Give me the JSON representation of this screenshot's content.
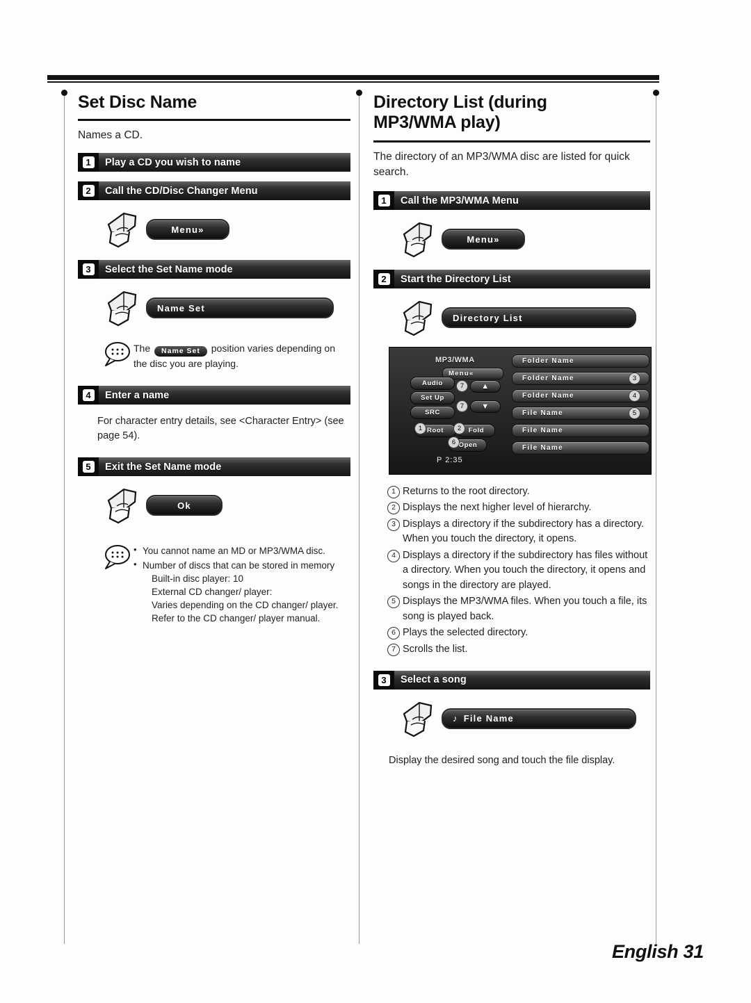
{
  "page": {
    "footer": "English 31"
  },
  "left": {
    "title": "Set Disc Name",
    "intro": "Names a CD.",
    "steps": [
      {
        "num": "1",
        "label": "Play a CD you wish to name"
      },
      {
        "num": "2",
        "label": "Call the CD/Disc Changer Menu"
      },
      {
        "num": "3",
        "label": "Select the Set Name mode"
      },
      {
        "num": "4",
        "label": "Enter a name"
      },
      {
        "num": "5",
        "label": "Exit the Set Name mode"
      }
    ],
    "buttons": {
      "menu": "Menu»",
      "name_set": "Name Set",
      "ok": "Ok"
    },
    "note1": {
      "prefix": "The",
      "pill": "Name Set",
      "suffix": "position varies depending on the disc you are playing."
    },
    "step4_text": "For character entry details, see <Character Entry> (see page 54).",
    "note2": [
      "You cannot name an MD or MP3/WMA disc.",
      "Number of discs that can be stored in memory"
    ],
    "note2_sub": [
      "Built-in disc player: 10",
      "External CD changer/ player:",
      "Varies depending on the CD changer/ player.",
      "Refer to the CD changer/ player manual."
    ]
  },
  "right": {
    "title": "Directory List (during MP3/WMA play)",
    "intro": "The directory of an MP3/WMA disc are listed for quick search.",
    "steps": [
      {
        "num": "1",
        "label": "Call the MP3/WMA Menu"
      },
      {
        "num": "2",
        "label": "Start the Directory List"
      },
      {
        "num": "3",
        "label": "Select a song"
      }
    ],
    "buttons": {
      "menu": "Menu»",
      "directory_list": "Directory List",
      "file_name": "File Name"
    },
    "device": {
      "title": "MP3/WMA",
      "menu_tab": "Menu«",
      "left_buttons": [
        "Audio",
        "Set Up",
        "SRC"
      ],
      "root": "Root",
      "folder": "Fold",
      "open": "Open",
      "time": "P  2:35",
      "rows": [
        {
          "text": "Folder Name",
          "badge": ""
        },
        {
          "text": "Folder Name",
          "badge": "3"
        },
        {
          "text": "Folder Name",
          "badge": "4"
        },
        {
          "text": "File Name",
          "badge": "5"
        },
        {
          "text": "File Name",
          "badge": ""
        },
        {
          "text": "File Name",
          "badge": ""
        }
      ],
      "callouts": [
        "1",
        "2",
        "6",
        "7",
        "7"
      ]
    },
    "explanations": [
      {
        "n": "1",
        "text": "Returns to the root directory."
      },
      {
        "n": "2",
        "text": "Displays the next higher level of hierarchy."
      },
      {
        "n": "3",
        "text": "Displays a directory if the subdirectory has a directory. When you touch the directory, it opens."
      },
      {
        "n": "4",
        "text": "Displays a directory if the subdirectory has files without a directory. When you touch the directory, it opens and songs in the directory are played."
      },
      {
        "n": "5",
        "text": "Displays the MP3/WMA files. When you touch a file, its song is played back."
      },
      {
        "n": "6",
        "text": "Plays the selected directory."
      },
      {
        "n": "7",
        "text": "Scrolls the list."
      }
    ],
    "closing": "Display the desired song and touch the file display."
  }
}
